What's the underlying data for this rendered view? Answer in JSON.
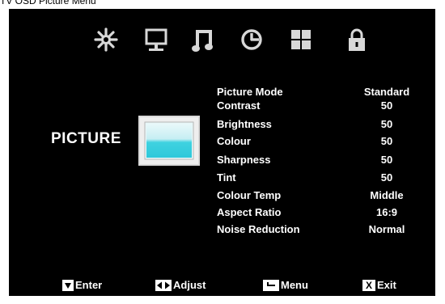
{
  "caption": "TV OSD Picture Menu",
  "icons": [
    {
      "name": "brightness-sun-icon"
    },
    {
      "name": "monitor-icon"
    },
    {
      "name": "music-note-icon"
    },
    {
      "name": "clock-icon"
    },
    {
      "name": "grid-icon"
    },
    {
      "name": "lock-icon"
    }
  ],
  "section_title": "PICTURE",
  "menu": [
    {
      "label": "Picture Mode",
      "value": "Standard"
    },
    {
      "label": "Contrast",
      "value": "50"
    },
    {
      "label": "Brightness",
      "value": "50"
    },
    {
      "label": "Colour",
      "value": "50"
    },
    {
      "label": "Sharpness",
      "value": "50"
    },
    {
      "label": "Tint",
      "value": "50"
    },
    {
      "label": "Colour Temp",
      "value": "Middle"
    },
    {
      "label": "Aspect Ratio",
      "value": "16:9"
    },
    {
      "label": "Noise Reduction",
      "value": "Normal"
    }
  ],
  "footer": {
    "enter_label": "Enter",
    "adjust_label": "Adjust",
    "menu_label": "Menu",
    "exit_key": "X",
    "exit_label": "Exit"
  },
  "colors": {
    "background": "#000000",
    "text": "#ffffff",
    "icon_gray": "#d8d8d8",
    "screen_cyan": "#3fd2e0"
  }
}
